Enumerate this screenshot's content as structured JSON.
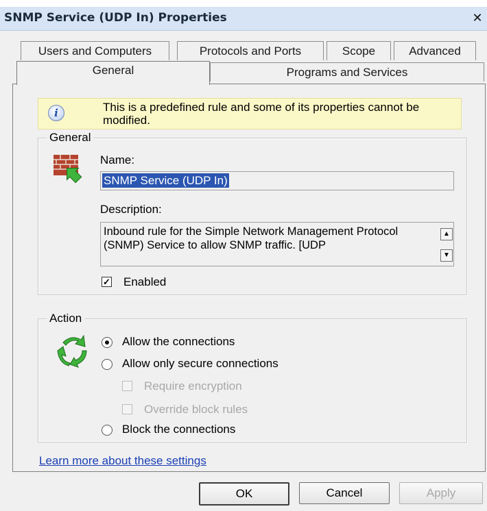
{
  "window": {
    "title": "SNMP Service (UDP In) Properties",
    "close_glyph": "✕"
  },
  "tabs": {
    "back_row": [
      "Users and Computers",
      "Protocols and Ports",
      "Scope",
      "Advanced"
    ],
    "front_row": [
      "General",
      "Programs and Services"
    ],
    "active": "General"
  },
  "info": {
    "icon": "info-icon",
    "message": "This is a predefined rule and some of its properties cannot be modified."
  },
  "general_group": {
    "legend": "General",
    "icon": "firewall-icon",
    "name_label": "Name:",
    "name_value": "SNMP Service (UDP In)",
    "description_label": "Description:",
    "description_value": "Inbound rule for the Simple Network Management Protocol (SNMP) Service to allow SNMP traffic. [UDP",
    "enabled_label": "Enabled",
    "enabled_checked": true
  },
  "action_group": {
    "legend": "Action",
    "icon": "arrows-cycle-icon",
    "allow_label": "Allow the connections",
    "allow_secure_label": "Allow only secure connections",
    "require_encryption_label": "Require encryption",
    "override_block_label": "Override block rules",
    "block_label": "Block the connections",
    "selected": "Allow the connections"
  },
  "link": {
    "text": "Learn more about these settings"
  },
  "buttons": {
    "ok": "OK",
    "cancel": "Cancel",
    "apply": "Apply"
  },
  "colors": {
    "selection": "#2b56b1",
    "banner": "#fbf8c8",
    "link": "#1a3fb5"
  }
}
